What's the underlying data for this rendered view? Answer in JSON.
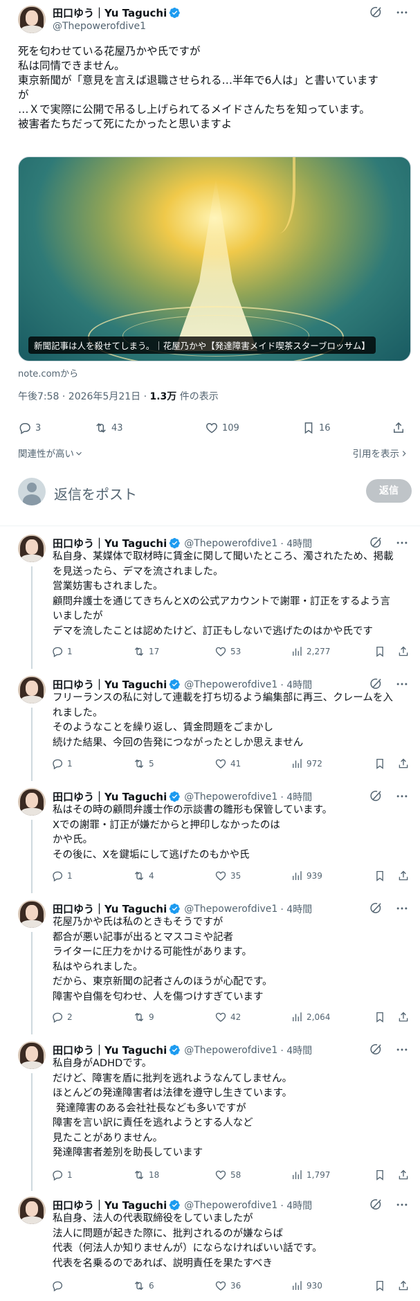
{
  "author": {
    "name": "田口ゆう｜Yu Taguchi",
    "handle": "@Thepowerofdive1"
  },
  "main_tweet": {
    "text": "死を匂わせている花屋乃かや氏ですが\n私は同情できません。\n東京新聞が「意見を言えば退職させられる…半年で6人は」と書いています\nが\n…Ｘで実際に公開で吊るし上げられてるメイドさんたちを知っています。\n被害者たちだって死にたかったと思いますよ",
    "card_title": "新聞記事は人を殺せてしまう。｜花屋乃かや【発達障害メイド喫茶スターブロッサム】",
    "source": "note.comから",
    "time": "午後7:58 · 2026年5月21日 · ",
    "views_count": "1.3万",
    "views_label": " 件の表示",
    "replies": "3",
    "reposts": "43",
    "likes": "109",
    "bookmarks": "16"
  },
  "sort": {
    "label": "関連性が高い",
    "quotes_label": "引用を表示"
  },
  "composer": {
    "placeholder": "返信をポスト",
    "button": "返信"
  },
  "replies": [
    {
      "time": "· 4時間",
      "text": "私自身、某媒体で取材時に賃金に関して聞いたところ、濁されたため、掲載\nを見送ったら、デマを流されました。\n営業妨害もされました。\n顧問弁護士を通じてきちんとXの公式アカウントで謝罪・訂正をするよう言\nいましたが\nデマを流したことは認めたけど、訂正もしないで逃げたのはかや氏です",
      "replies": "1",
      "reposts": "17",
      "likes": "53",
      "views": "2,277"
    },
    {
      "time": "· 4時間",
      "text": "フリーランスの私に対して連載を打ち切るよう編集部に再三、クレームを入\nれました。\nそのようなことを繰り返し、賃金問題をごまかし\n続けた結果、今回の告発につながったとしか思えません",
      "replies": "1",
      "reposts": "5",
      "likes": "41",
      "views": "972"
    },
    {
      "time": "· 4時間",
      "text": "私はその時の顧問弁護士作の示談書の雛形も保管しています。\nXでの謝罪・訂正が嫌だからと押印しなかったのは\nかや氏。\nその後に、Xを鍵垢にして逃げたのもかや氏",
      "replies": "1",
      "reposts": "4",
      "likes": "35",
      "views": "939"
    },
    {
      "time": "· 4時間",
      "text": "花屋乃かや氏は私のときもそうですが\n都合が悪い記事が出るとマスコミや記者\nライターに圧力をかける可能性があります。\n私はやられました。\nだから、東京新聞の記者さんのほうが心配です。\n障害や自傷を匂わせ、人を傷つけすぎています",
      "replies": "2",
      "reposts": "9",
      "likes": "42",
      "views": "2,064"
    },
    {
      "time": "· 4時間",
      "text": "私自身がADHDです。\nだけど、障害を盾に批判を逃れようなんてしません。\nほとんどの発達障害者は法律を遵守し生きています。\n 発達障害のある会社社長なども多いですが\n障害を言い訳に責任を逃れようとする人など\n見たことがありません。\n発達障害者差別を助長しています",
      "replies": "1",
      "reposts": "18",
      "likes": "58",
      "views": "1,797"
    },
    {
      "time": "· 4時間",
      "text": "私自身、法人の代表取締役をしていましたが\n法人に問題が起きた際に、批判されるのが嫌ならば\n代表（何法人か知りませんが）にならなければいい話です。\n代表を名乗るのであれば、説明責任を果たすべき",
      "replies": "",
      "reposts": "6",
      "likes": "36",
      "views": "930"
    }
  ],
  "colors": {
    "text": "#0f1419",
    "muted": "#536471",
    "verified": "#1d9bf0",
    "border": "#eff3f4"
  }
}
